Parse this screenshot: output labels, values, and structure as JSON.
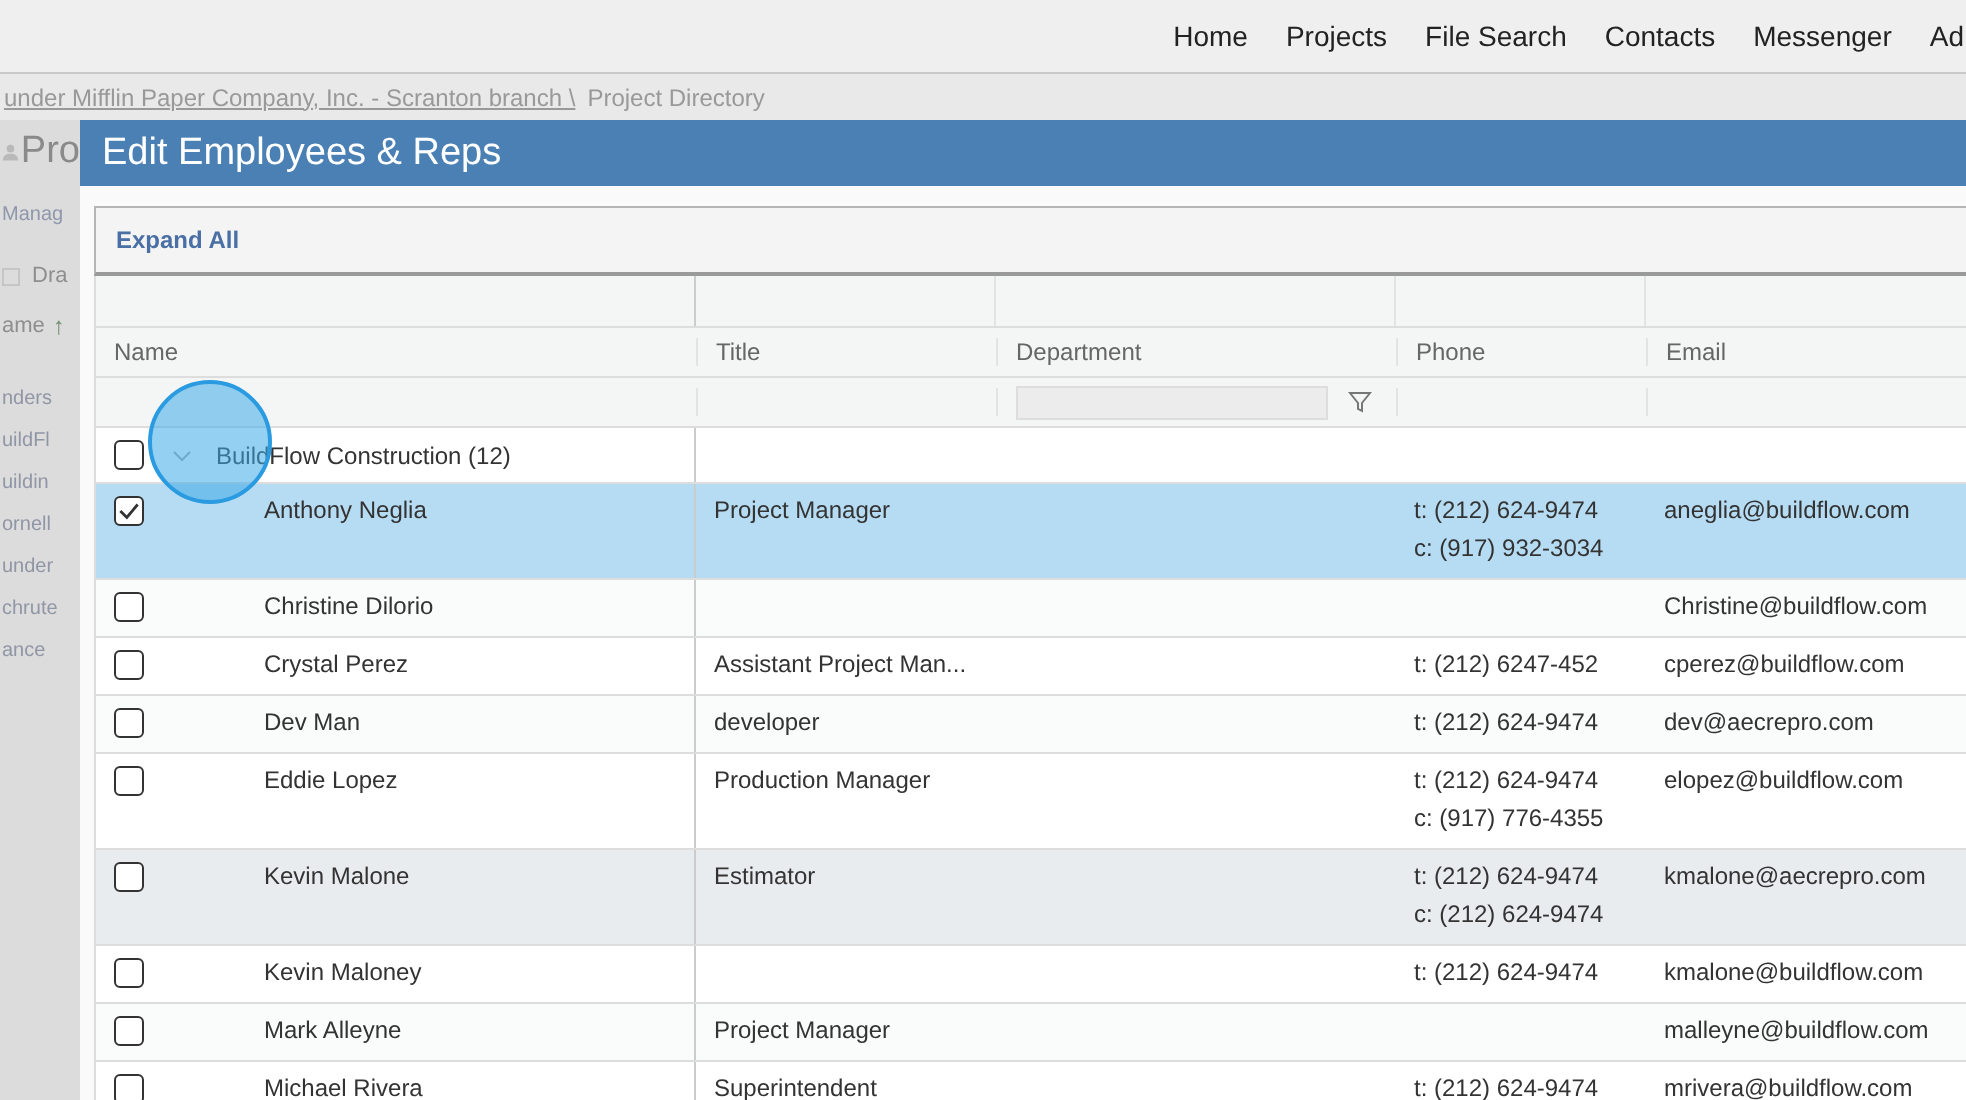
{
  "nav": [
    "Home",
    "Projects",
    "File Search",
    "Contacts",
    "Messenger",
    "Ad"
  ],
  "breadcrumb": {
    "link": "under Mifflin Paper Company, Inc. - Scranton branch \\",
    "current": "Project Directory"
  },
  "background_page": {
    "title": "Pro",
    "tab": "Manag",
    "drag_label": "Dra",
    "sort_column": "ame",
    "sort_arrow": "↑",
    "items": [
      "nders",
      "uildFl",
      "uildin",
      "ornell",
      "under",
      "chrute",
      "ance"
    ]
  },
  "dialog": {
    "title": "Edit Employees & Reps",
    "toolbar_button": "Expand All",
    "columns": [
      "Name",
      "Title",
      "Department",
      "Phone",
      "Email"
    ],
    "group": {
      "label": "BuildFlow Construction (12)",
      "checked": false,
      "expanded": true
    },
    "rows": [
      {
        "name": "Anthony Neglia",
        "title": "Project Manager",
        "phones": [
          "t: (212) 624-9474",
          "c: (917) 932-3034"
        ],
        "email": "aneglia@buildflow.com",
        "checked": true,
        "selected": true,
        "hovered": false
      },
      {
        "name": "Christine Dilorio",
        "phones": [],
        "email": "Christine@buildflow.com",
        "checked": false,
        "selected": false,
        "hovered": false
      },
      {
        "name": "Crystal Perez",
        "title": "Assistant Project Man...",
        "phones": [
          "t: (212) 6247-452"
        ],
        "email": "cperez@buildflow.com",
        "checked": false,
        "selected": false,
        "hovered": false
      },
      {
        "name": "Dev Man",
        "title": "developer",
        "phones": [
          "t: (212) 624-9474"
        ],
        "email": "dev@aecrepro.com",
        "checked": false,
        "selected": false,
        "hovered": false
      },
      {
        "name": "Eddie Lopez",
        "title": "Production Manager",
        "phones": [
          "t: (212) 624-9474",
          "c: (917) 776-4355"
        ],
        "email": "elopez@buildflow.com",
        "checked": false,
        "selected": false,
        "hovered": false
      },
      {
        "name": "Kevin Malone",
        "title": "Estimator",
        "phones": [
          "t: (212) 624-9474",
          "c: (212) 624-9474"
        ],
        "email": "kmalone@aecrepro.com",
        "checked": false,
        "selected": false,
        "hovered": true
      },
      {
        "name": "Kevin Maloney",
        "phones": [
          "t: (212) 624-9474"
        ],
        "email": "kmalone@buildflow.com",
        "checked": false,
        "selected": false,
        "hovered": false
      },
      {
        "name": "Mark Alleyne",
        "title": "Project Manager",
        "phones": [],
        "email": "malleyne@buildflow.com",
        "checked": false,
        "selected": false,
        "hovered": false
      },
      {
        "name": "Michael Rivera",
        "title": "Superintendent",
        "phones": [
          "t: (212) 624-9474"
        ],
        "email": "mrivera@buildflow.com",
        "checked": false,
        "selected": false,
        "hovered": false
      }
    ]
  }
}
